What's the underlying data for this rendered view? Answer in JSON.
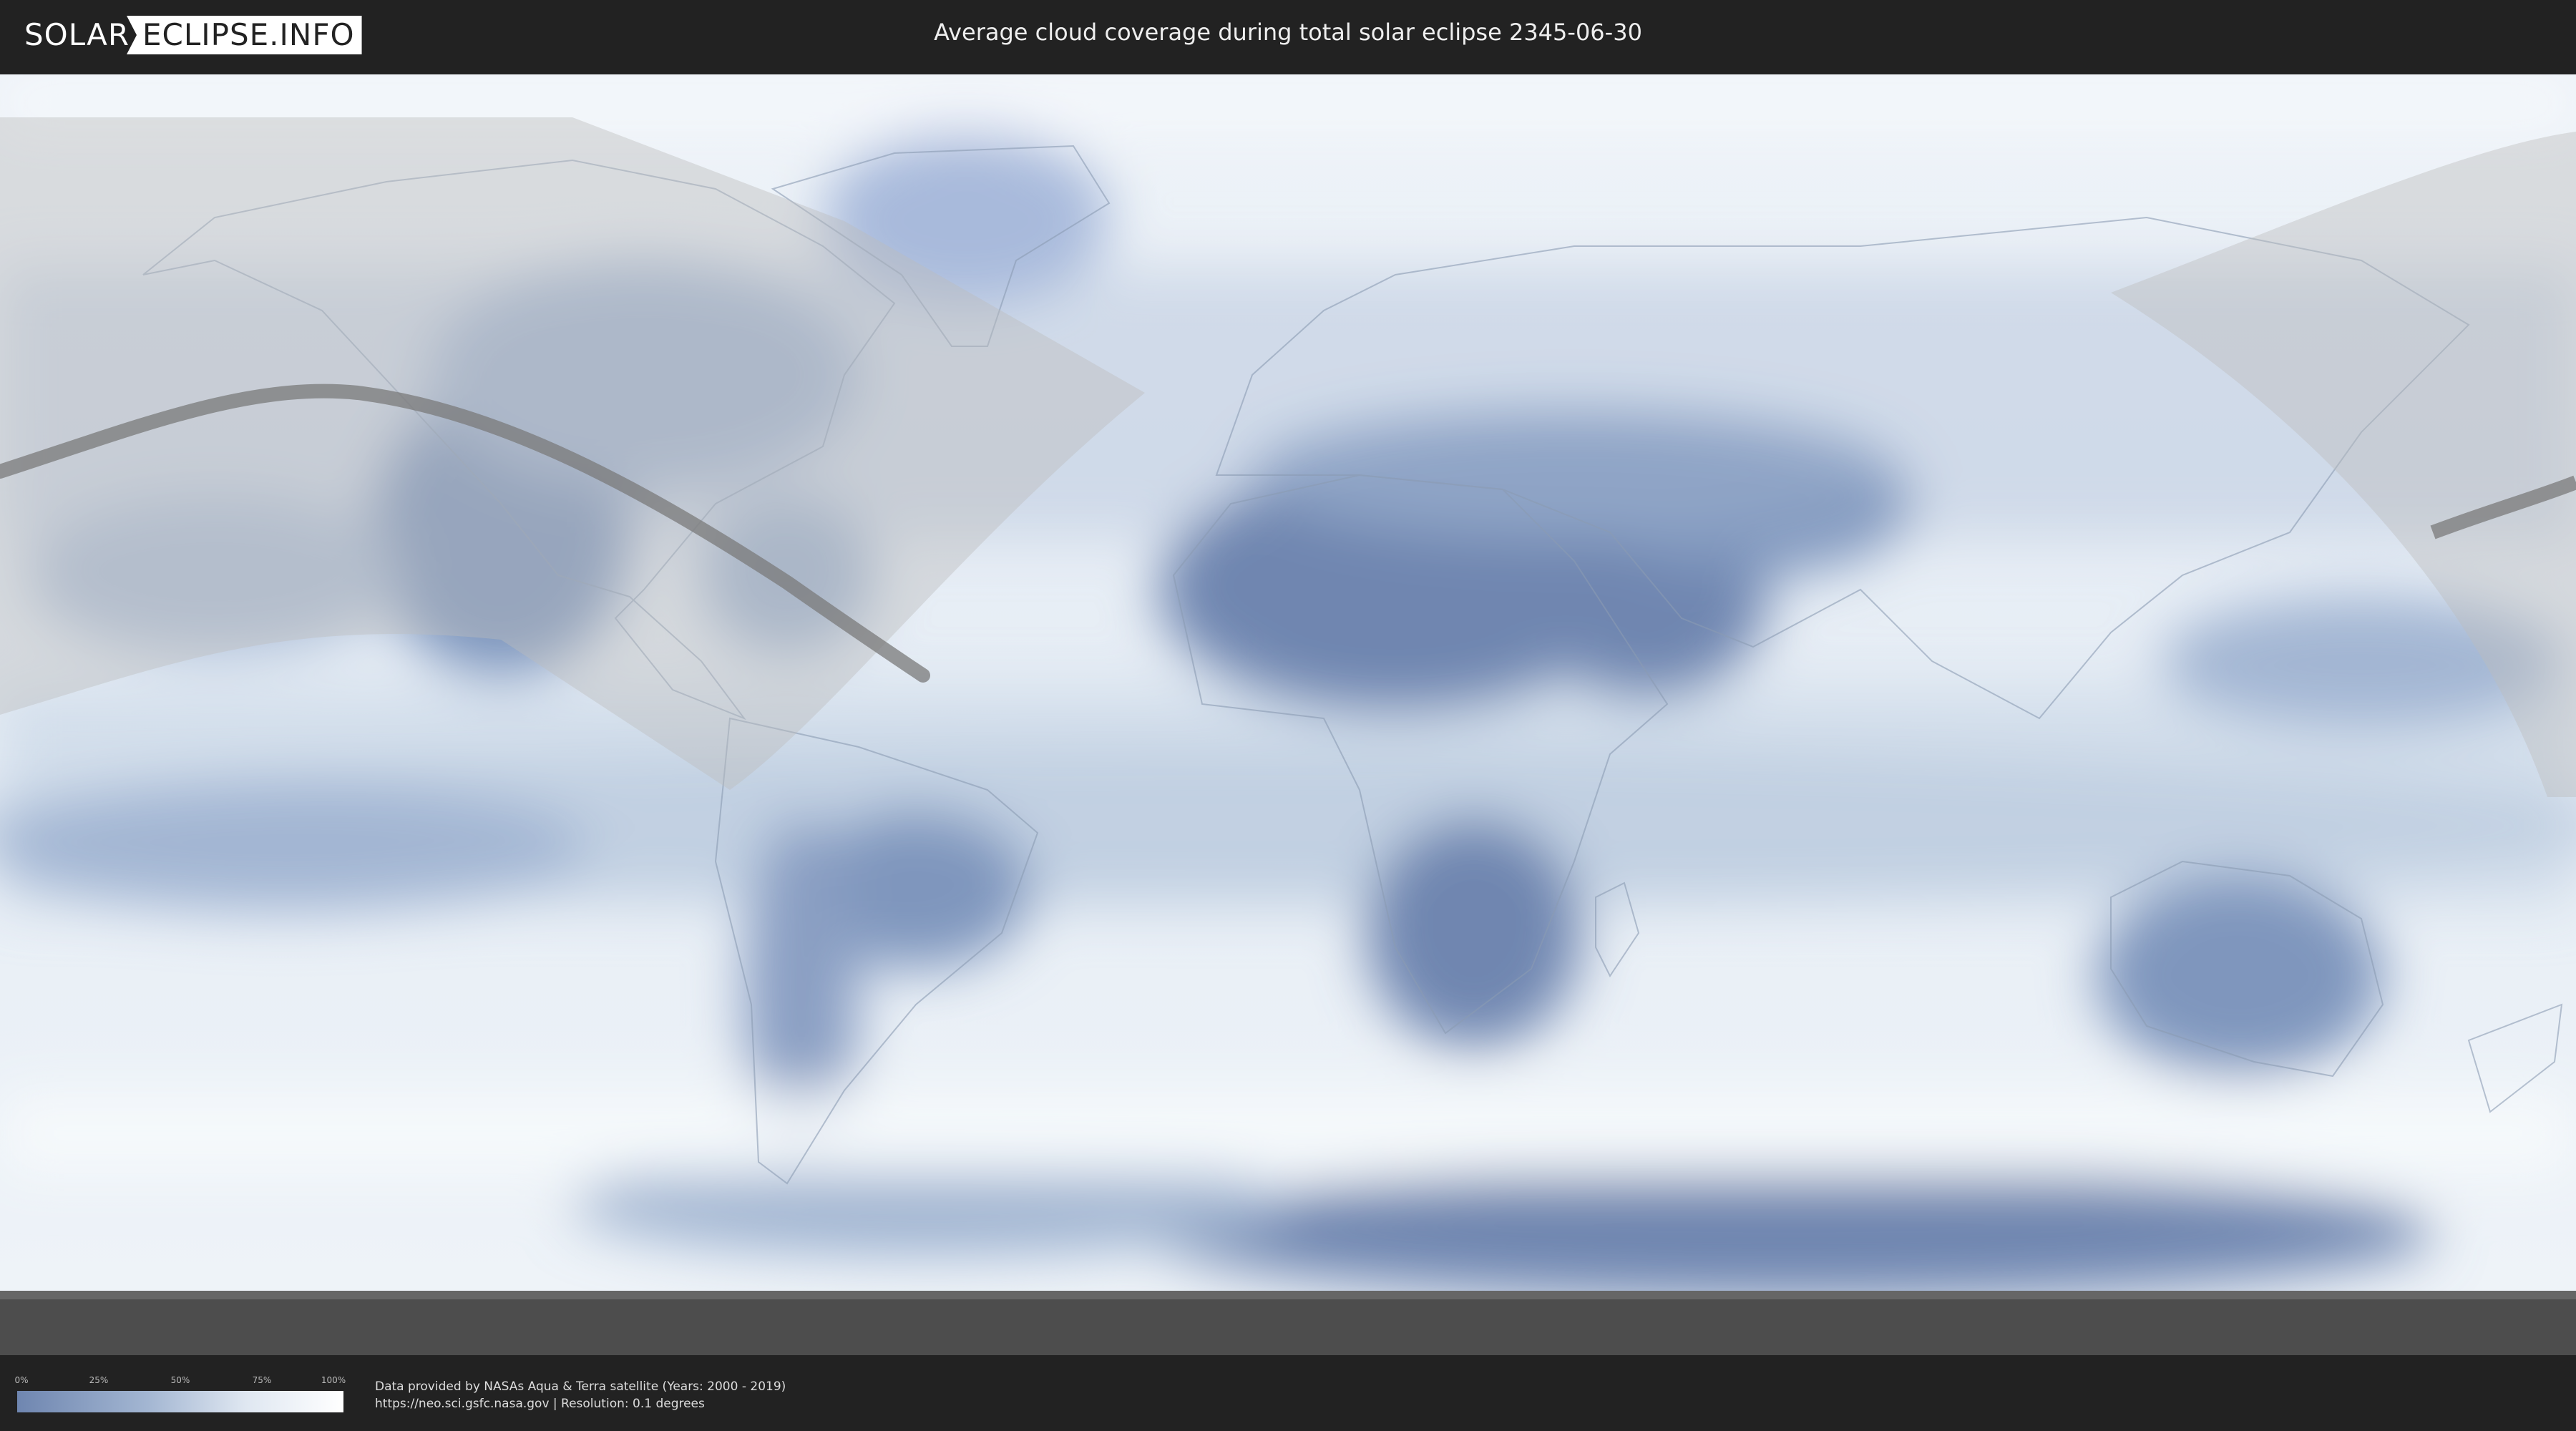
{
  "header": {
    "logo_left": "SOLAR",
    "logo_right": "ECLIPSE.INFO",
    "title": "Average cloud coverage during total solar eclipse 2345-06-30"
  },
  "legend": {
    "ticks": [
      "0%",
      "25%",
      "50%",
      "75%",
      "100%"
    ],
    "gradient_colors": [
      "#6f86b0",
      "#a3b6d2",
      "#dfe7f1",
      "#ffffff"
    ]
  },
  "footer": {
    "credit_line1": "Data provided by NASAs Aqua & Terra satellite (Years: 2000 - 2019)",
    "credit_line2": "https://neo.sci.gsfc.nasa.gov | Resolution: 0.1 degrees"
  },
  "colors": {
    "background": "#222222",
    "clear_sky": "#6f86b0",
    "cloudy": "#f2f6fa",
    "eclipse_path": "#7a7a7a"
  }
}
